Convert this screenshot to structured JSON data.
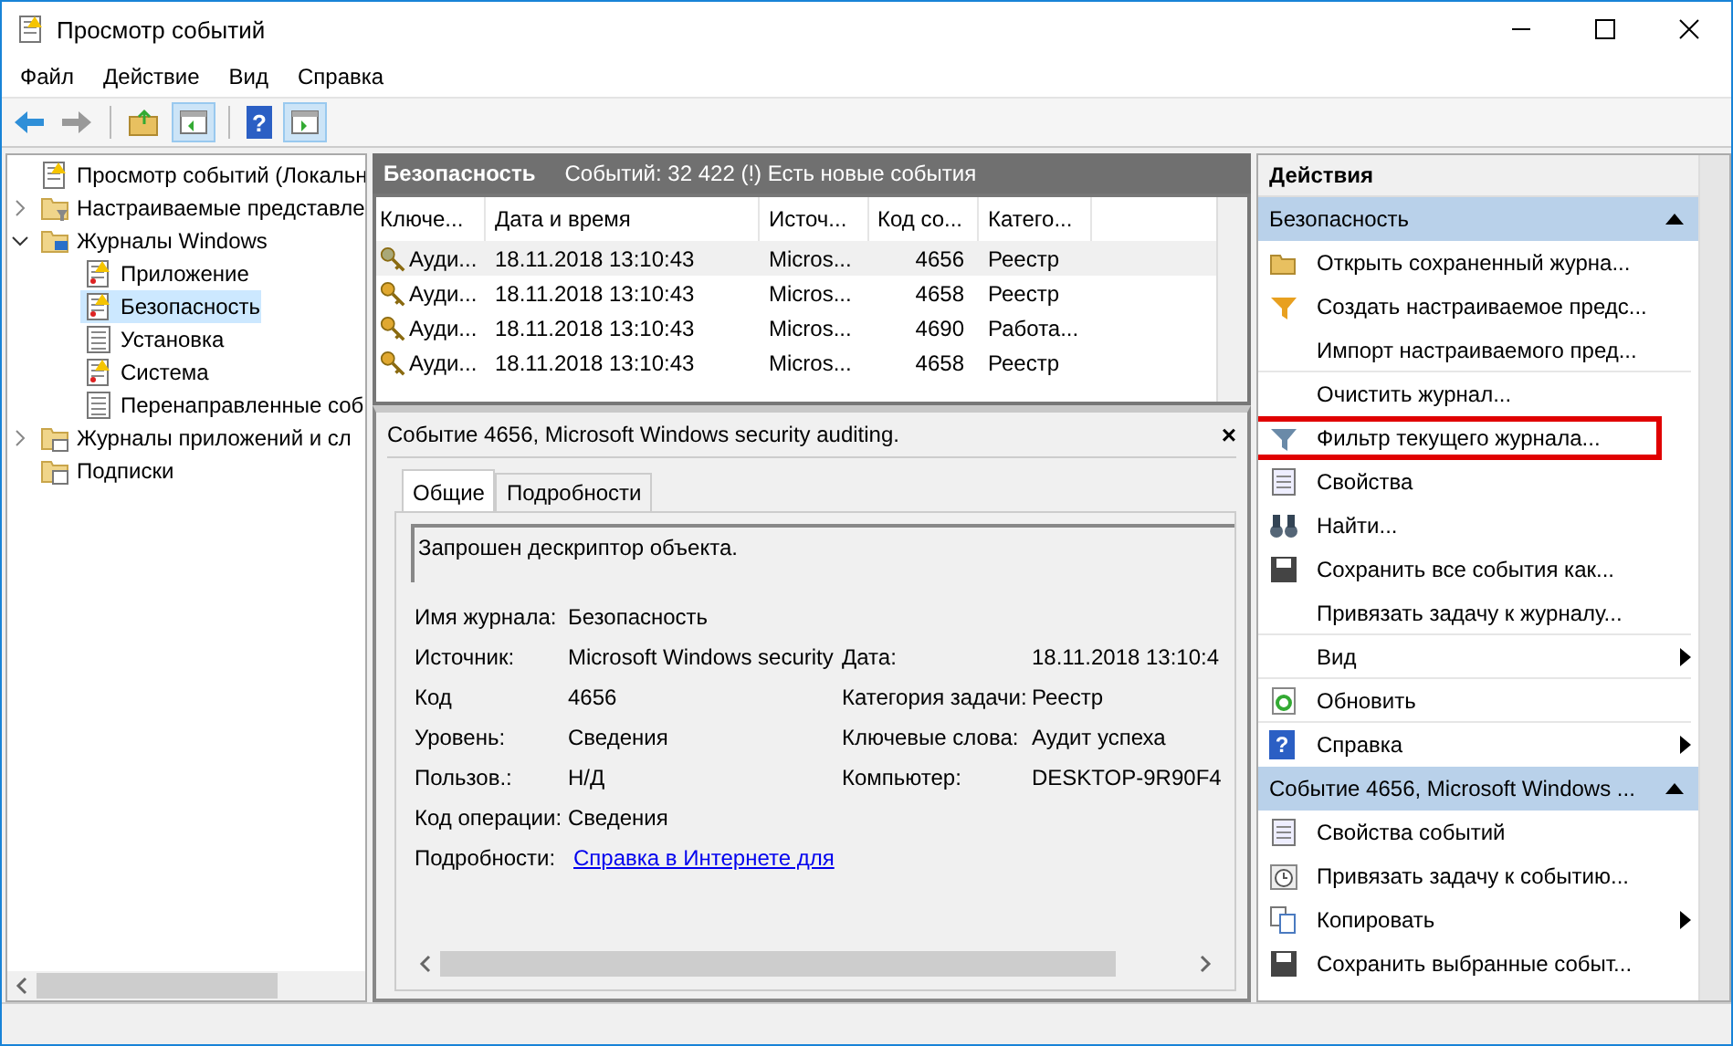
{
  "window": {
    "title": "Просмотр событий"
  },
  "menu": [
    "Файл",
    "Действие",
    "Вид",
    "Справка"
  ],
  "toolbar": {
    "help_glyph": "?"
  },
  "tree": [
    {
      "label": "Просмотр событий (Локальн",
      "kind": "log",
      "selected": false
    },
    {
      "label": "Настраиваемые представле",
      "kind": "filter",
      "expanded": false,
      "selected": false
    },
    {
      "label": "Журналы Windows",
      "kind": "computer",
      "expanded": true,
      "selected": false,
      "children": [
        {
          "label": "Приложение",
          "kind": "log",
          "selected": false
        },
        {
          "label": "Безопасность",
          "kind": "log",
          "selected": true
        },
        {
          "label": "Установка",
          "kind": "list",
          "selected": false
        },
        {
          "label": "Система",
          "kind": "log",
          "selected": false
        },
        {
          "label": "Перенаправленные соб",
          "kind": "list",
          "selected": false
        }
      ]
    },
    {
      "label": "Журналы приложений и сл",
      "kind": "folder",
      "expanded": false,
      "selected": false
    },
    {
      "label": "Подписки",
      "kind": "document",
      "selected": false
    }
  ],
  "log_header": {
    "title": "Безопасность",
    "summary": "Событий: 32 422 (!) Есть новые события"
  },
  "table": {
    "columns": [
      "Ключе...",
      "Дата и время",
      "Источ...",
      "Код со...",
      "Катего..."
    ],
    "rows": [
      {
        "cells": [
          "Ауди...",
          "18.11.2018 13:10:43",
          "Micros...",
          "4656",
          "Реестр"
        ],
        "selected": true
      },
      {
        "cells": [
          "Ауди...",
          "18.11.2018 13:10:43",
          "Micros...",
          "4658",
          "Реестр"
        ],
        "selected": false
      },
      {
        "cells": [
          "Ауди...",
          "18.11.2018 13:10:43",
          "Micros...",
          "4690",
          "Работа..."
        ],
        "selected": false
      },
      {
        "cells": [
          "Ауди...",
          "18.11.2018 13:10:43",
          "Micros...",
          "4658",
          "Реестр"
        ],
        "selected": false
      }
    ]
  },
  "event": {
    "title": "Событие 4656, Microsoft Windows security auditing.",
    "close": "×",
    "tabs": [
      {
        "label": "Общие",
        "selected": true
      },
      {
        "label": "Подробности",
        "selected": false
      }
    ],
    "description": "Запрошен дескриптор объекта.",
    "fields": [
      {
        "left": {
          "label": "Имя журнала:",
          "value": "Безопасность",
          "kind": "text"
        }
      },
      {
        "left": {
          "label": "Источник:",
          "value": "Microsoft Windows security",
          "kind": "text"
        },
        "right": {
          "label": "Дата:",
          "value": "18.11.2018 13:10:4"
        }
      },
      {
        "left": {
          "label": "Код",
          "value": "4656",
          "kind": "text"
        },
        "right": {
          "label": "Категория задачи:",
          "value": "Реестр"
        }
      },
      {
        "left": {
          "label": "Уровень:",
          "value": "Сведения",
          "kind": "text"
        },
        "right": {
          "label": "Ключевые слова:",
          "value": "Аудит успеха"
        }
      },
      {
        "left": {
          "label": "Пользов.:",
          "value": "Н/Д",
          "kind": "text"
        },
        "right": {
          "label": "Компьютер:",
          "value": "DESKTOP-9R90F4"
        }
      },
      {
        "left": {
          "label": "Код операции:",
          "value": "Сведения",
          "kind": "text"
        }
      },
      {
        "left": {
          "label": "Подробности:",
          "value": "Справка в Интернете для",
          "kind": "link"
        }
      }
    ]
  },
  "actions": {
    "title": "Действия",
    "sections": [
      {
        "title": "Безопасность",
        "items": [
          {
            "label": "Открыть сохраненный журна...",
            "kind": "open",
            "submenu": false,
            "highlighted": false,
            "divider": false
          },
          {
            "label": "Создать настраиваемое предс...",
            "kind": "filter-new",
            "submenu": false,
            "highlighted": false,
            "divider": false
          },
          {
            "label": "Импорт настраиваемого пред...",
            "kind": "plain",
            "submenu": false,
            "highlighted": false,
            "divider": true
          },
          {
            "label": "Очистить журнал...",
            "kind": "plain",
            "submenu": false,
            "highlighted": false,
            "divider": false
          },
          {
            "label": "Фильтр текущего журнала...",
            "kind": "filter",
            "submenu": false,
            "highlighted": true,
            "divider": false
          },
          {
            "label": "Свойства",
            "kind": "props",
            "submenu": false,
            "highlighted": false,
            "divider": false
          },
          {
            "label": "Найти...",
            "kind": "find",
            "submenu": false,
            "highlighted": false,
            "divider": false
          },
          {
            "label": "Сохранить все события как...",
            "kind": "save",
            "submenu": false,
            "highlighted": false,
            "divider": false
          },
          {
            "label": "Привязать задачу к журналу...",
            "kind": "plain",
            "submenu": false,
            "highlighted": false,
            "divider": true
          },
          {
            "label": "Вид",
            "kind": "plain",
            "submenu": true,
            "highlighted": false,
            "divider": true
          },
          {
            "label": "Обновить",
            "kind": "refresh",
            "submenu": false,
            "highlighted": false,
            "divider": true
          },
          {
            "label": "Справка",
            "kind": "help",
            "glyph": "?",
            "submenu": true,
            "highlighted": false,
            "divider": false
          }
        ]
      },
      {
        "title": "Событие 4656, Microsoft Windows ...",
        "items": [
          {
            "label": "Свойства событий",
            "kind": "props",
            "submenu": false,
            "highlighted": false,
            "divider": false
          },
          {
            "label": "Привязать задачу к событию...",
            "kind": "task",
            "submenu": false,
            "highlighted": false,
            "divider": false
          },
          {
            "label": "Копировать",
            "kind": "copy",
            "submenu": true,
            "highlighted": false,
            "divider": false
          },
          {
            "label": "Сохранить выбранные событ...",
            "kind": "save",
            "submenu": false,
            "highlighted": false,
            "divider": false
          }
        ]
      }
    ]
  }
}
